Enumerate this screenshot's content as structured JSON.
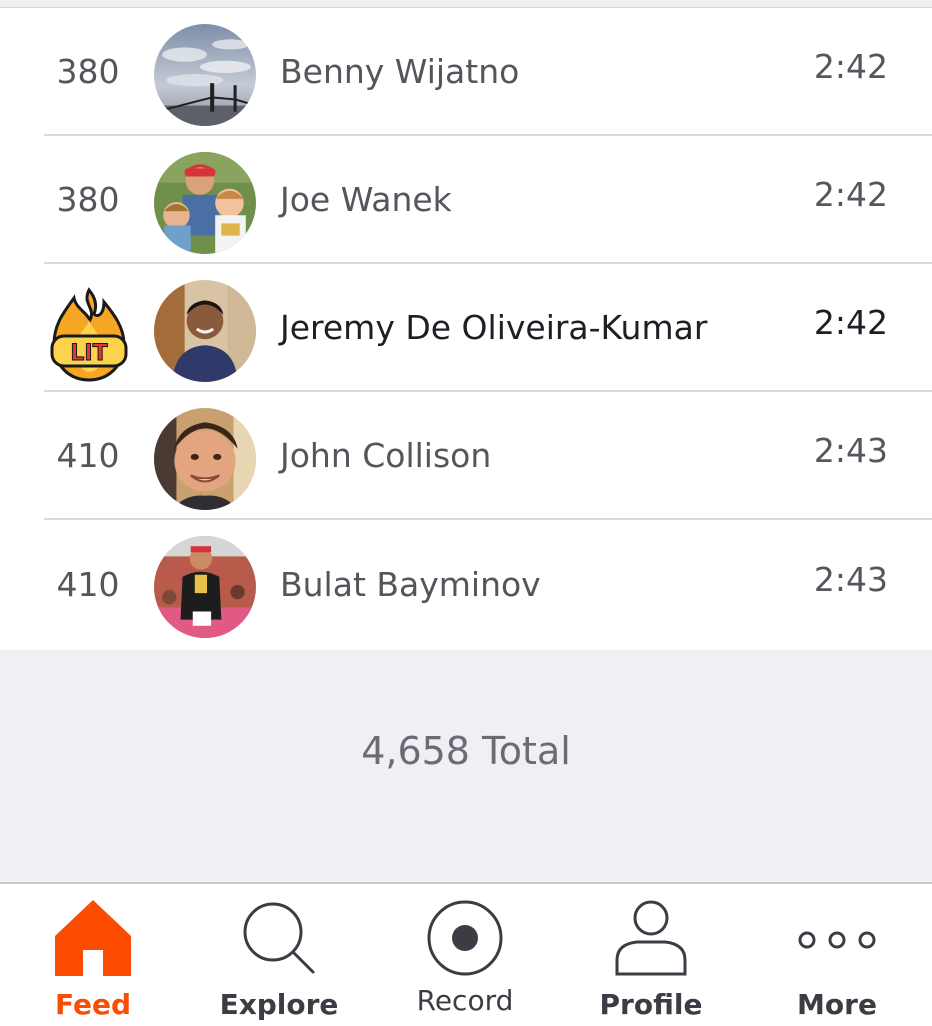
{
  "leaderboard": [
    {
      "rank": "380",
      "name": "Benny Wijatno",
      "time": "2:42"
    },
    {
      "rank": "380",
      "name": "Joe Wanek",
      "time": "2:42"
    },
    {
      "rank": "",
      "name": "Jeremy De Oliveira-Kumar",
      "time": "2:42",
      "badge": "LIT"
    },
    {
      "rank": "410",
      "name": "John Collison",
      "time": "2:43"
    },
    {
      "rank": "410",
      "name": "Bulat Bayminov",
      "time": "2:43"
    }
  ],
  "footer": {
    "total": "4,658 Total"
  },
  "tabbar": {
    "items": [
      {
        "label": "Feed",
        "icon": "home-icon",
        "active": true
      },
      {
        "label": "Explore",
        "icon": "search-icon"
      },
      {
        "label": "Record",
        "icon": "record-icon"
      },
      {
        "label": "Profile",
        "icon": "profile-icon"
      },
      {
        "label": "More",
        "icon": "more-icon"
      }
    ]
  },
  "colors": {
    "accent": "#fc4c02",
    "background": "#efeff4",
    "divider": "#d9d9df"
  }
}
